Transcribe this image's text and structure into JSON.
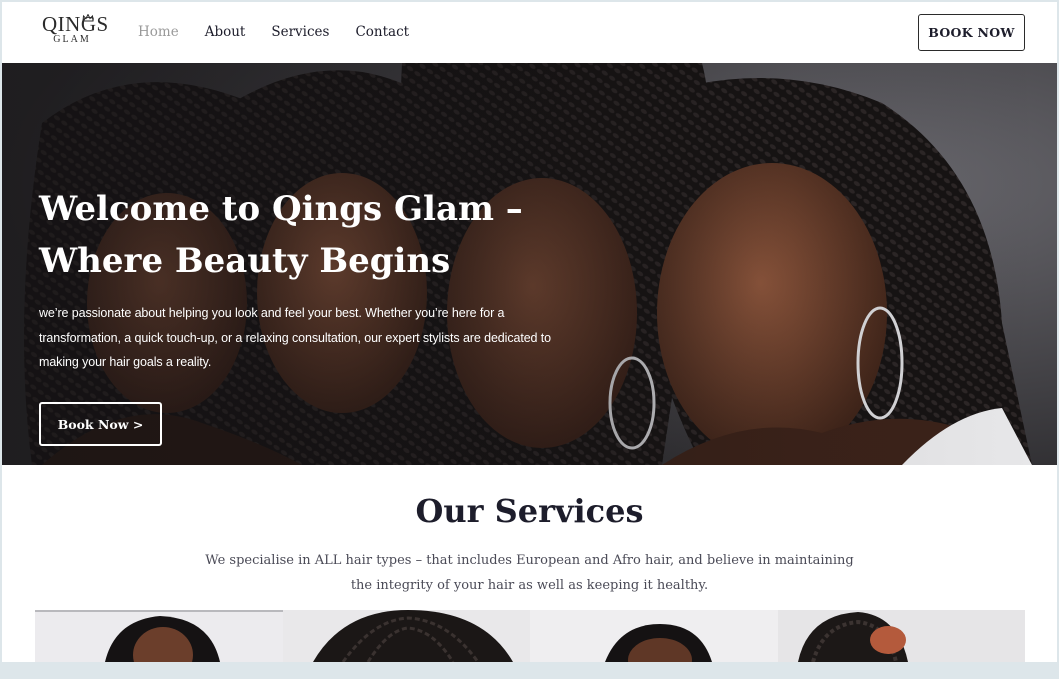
{
  "brand": {
    "logo_main": "QINGS",
    "logo_sub": "GLAM"
  },
  "nav": {
    "items": [
      {
        "label": "Home",
        "active": true
      },
      {
        "label": "About",
        "active": false
      },
      {
        "label": "Services",
        "active": false
      },
      {
        "label": "Contact",
        "active": false
      }
    ]
  },
  "header": {
    "book_label": "BOOK NOW"
  },
  "hero": {
    "title_lines": [
      "Welcome to Qings Glam –",
      "Where Beauty Begins"
    ],
    "text_lines": [
      "we’re passionate about helping you look and feel your best. Whether you’re here for a",
      "transformation, a quick touch-up, or a relaxing consultation, our expert stylists are dedicated to",
      "making your hair goals a reality."
    ],
    "button_label": "Book Now >"
  },
  "services": {
    "title": "Our Services",
    "text_lines": [
      "We specialise in ALL hair types – that includes European and Afro hair, and believe in maintaining",
      "the integrity of your hair as well as keeping it healthy."
    ]
  },
  "colors": {
    "text_dark": "#1d1d2b",
    "nav_active": "#9a9a9a",
    "page_bg": "#dde6ea"
  }
}
